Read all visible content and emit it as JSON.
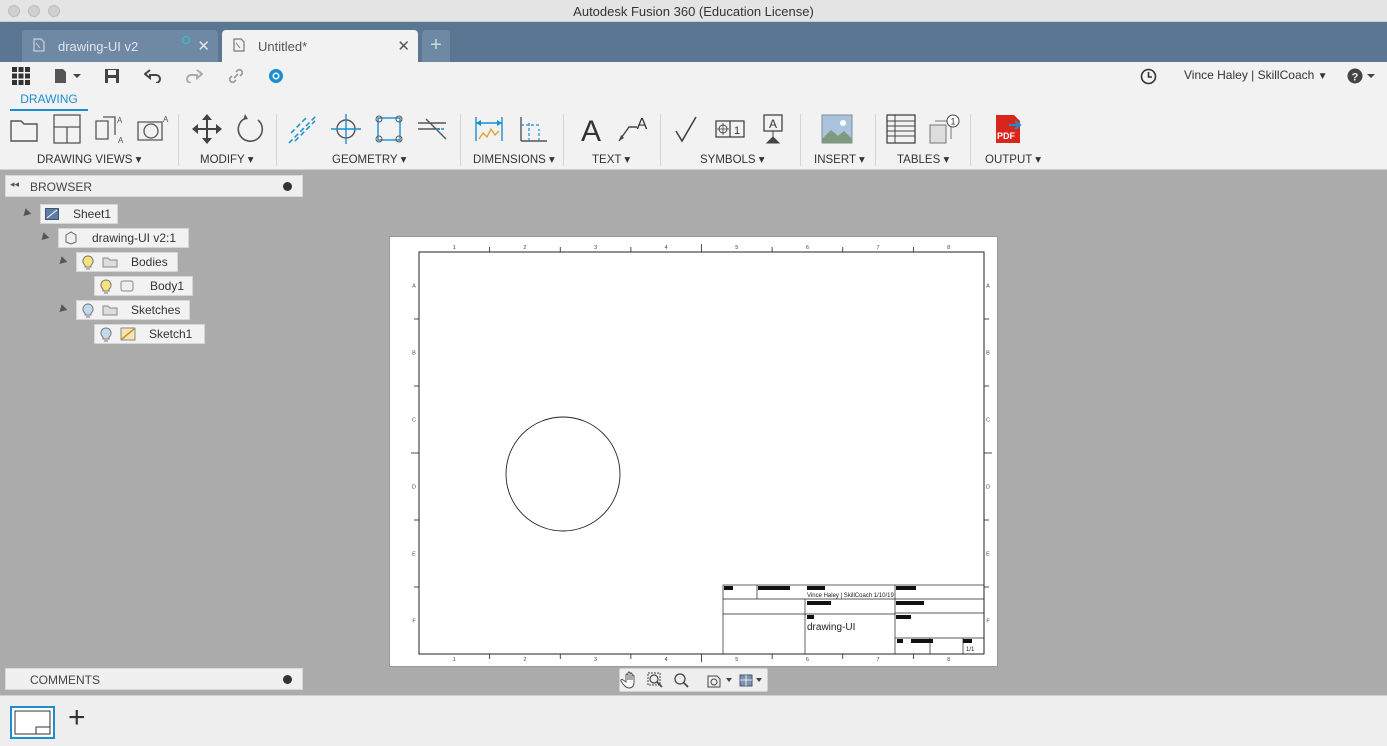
{
  "window": {
    "title": "Autodesk Fusion 360 (Education License)"
  },
  "tabs": [
    {
      "label": "drawing-UI v2",
      "active": false
    },
    {
      "label": "Untitled*",
      "active": true
    }
  ],
  "quick_access": {
    "user": "Vince Haley | SkillCoach"
  },
  "workspace_tab": "DRAWING",
  "ribbon_groups": [
    {
      "label": "DRAWING VIEWS ▾"
    },
    {
      "label": "MODIFY ▾"
    },
    {
      "label": "GEOMETRY ▾"
    },
    {
      "label": "DIMENSIONS ▾"
    },
    {
      "label": "TEXT ▾"
    },
    {
      "label": "SYMBOLS ▾"
    },
    {
      "label": "INSERT ▾"
    },
    {
      "label": "TABLES ▾"
    },
    {
      "label": "OUTPUT ▾"
    }
  ],
  "browser": {
    "title": "BROWSER",
    "tree": [
      {
        "label": "Sheet1"
      },
      {
        "label": "drawing-UI v2:1"
      },
      {
        "label": "Bodies"
      },
      {
        "label": "Body1"
      },
      {
        "label": "Sketches"
      },
      {
        "label": "Sketch1"
      }
    ]
  },
  "comments": {
    "title": "COMMENTS"
  },
  "sheet": {
    "col_labels": [
      "1",
      "2",
      "3",
      "4",
      "5",
      "6",
      "7",
      "8"
    ],
    "row_labels": [
      "A",
      "B",
      "C",
      "D",
      "E",
      "F"
    ],
    "title_block": {
      "author_date": "Vince Haley | SkillCoach 1/10/19",
      "title": "drawing-UI",
      "sheet_no": "1/1"
    }
  },
  "colors": {
    "accent": "#1a8fd0",
    "tabstrip": "#5a7693",
    "canvas": "#ababab",
    "pdf_red": "#d9261c"
  }
}
